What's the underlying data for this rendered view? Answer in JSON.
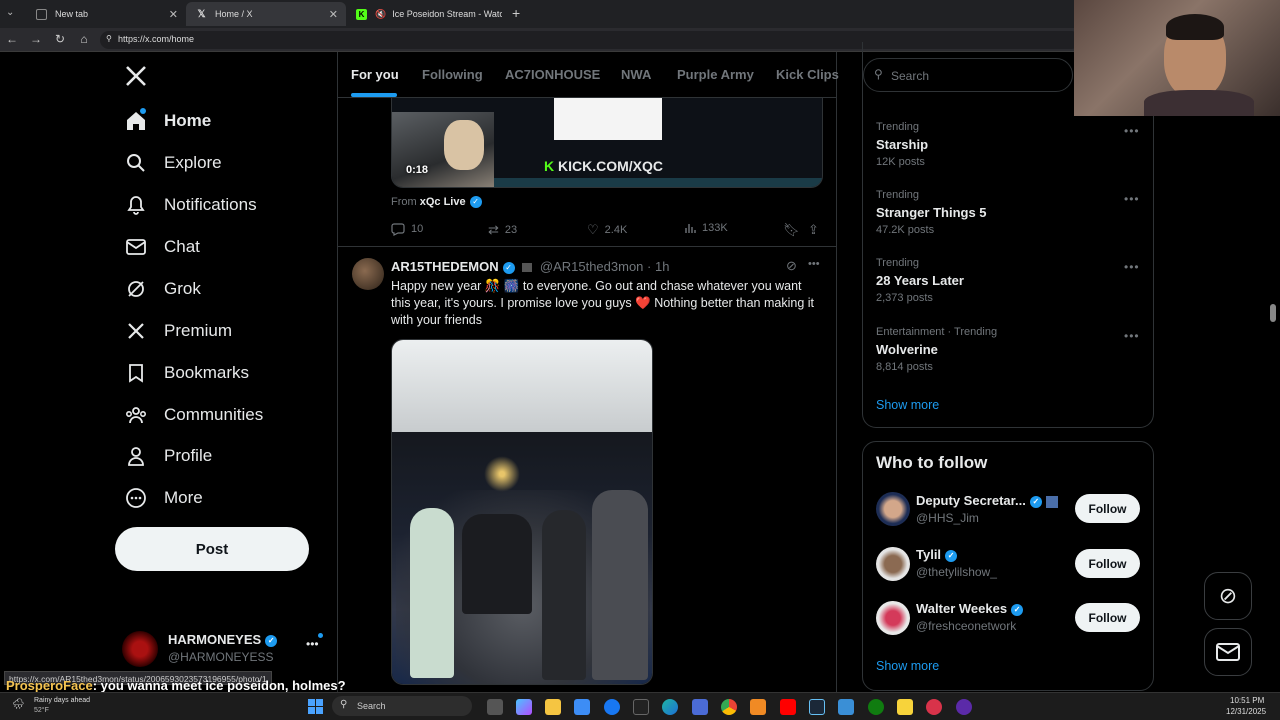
{
  "browser": {
    "tabs": [
      {
        "label": "New tab"
      },
      {
        "label": "Home / X"
      },
      {
        "label": "Ice Poseidon Stream - Watch"
      }
    ],
    "url": "https://x.com/home"
  },
  "sidebar": {
    "items": [
      {
        "label": "Home",
        "icon": "home-icon"
      },
      {
        "label": "Explore",
        "icon": "search-icon"
      },
      {
        "label": "Notifications",
        "icon": "bell-icon"
      },
      {
        "label": "Chat",
        "icon": "mail-icon"
      },
      {
        "label": "Grok",
        "icon": "grok-icon"
      },
      {
        "label": "Premium",
        "icon": "x-logo-icon"
      },
      {
        "label": "Bookmarks",
        "icon": "bookmark-icon"
      },
      {
        "label": "Communities",
        "icon": "communities-icon"
      },
      {
        "label": "Profile",
        "icon": "profile-icon"
      },
      {
        "label": "More",
        "icon": "more-circle-icon"
      }
    ],
    "post_label": "Post",
    "account_name": "HARMONEYES",
    "account_handle": "@HARMONEYESS"
  },
  "feed": {
    "tabs": [
      "For you",
      "Following",
      "AC7IONHOUSE",
      "NWA",
      "Purple Army",
      "Kick Clips"
    ],
    "post1": {
      "video_time": "0:18",
      "kick_text": "KICK.COM/XQC",
      "from_prefix": "From",
      "from_name": "xQc Live",
      "replies": "10",
      "reposts": "23",
      "likes": "2.4K",
      "views": "133K"
    },
    "post2": {
      "name": "AR15THEDEMON",
      "handle": "@AR15thed3mon",
      "time": "· 1h",
      "text": "Happy new year 🎊 🎆 to everyone. Go out and chase whatever you want this year, it's yours. I promise love you guys ❤️ Nothing better than making it with your friends"
    }
  },
  "search": {
    "placeholder": "Search"
  },
  "trends": [
    {
      "context": "Trending",
      "name": "Starship",
      "posts": "12K posts"
    },
    {
      "context": "Trending",
      "name": "Stranger Things 5",
      "posts": "47.2K posts"
    },
    {
      "context": "Trending",
      "name": "28 Years Later",
      "posts": "2,373 posts"
    },
    {
      "context": "Entertainment · Trending",
      "name": "Wolverine",
      "posts": "8,814 posts"
    }
  ],
  "show_more": "Show more",
  "who_to_follow": {
    "title": "Who to follow",
    "accounts": [
      {
        "name": "Deputy Secretar...",
        "handle": "@HHS_Jim",
        "button": "Follow"
      },
      {
        "name": "Tylil",
        "handle": "@thetylilshow_",
        "button": "Follow"
      },
      {
        "name": "Walter Weekes",
        "handle": "@freshceonetwork",
        "button": "Follow"
      }
    ],
    "show_more": "Show more"
  },
  "status_url": "https://x.com/AR15thed3mon/status/2006593023573196955/photo/1",
  "chat_overlay": {
    "user": "ProsperoFace",
    "message": ": you wanna meet ice poseidon, holmes?"
  },
  "taskbar": {
    "weather_title": "Rainy days ahead",
    "weather_temp": "52°F",
    "search_label": "Search",
    "time": "10:51 PM",
    "date": "12/31/2025"
  },
  "colors": {
    "accent": "#1d9bf0",
    "background": "#000000",
    "like_red": "#f91880"
  }
}
